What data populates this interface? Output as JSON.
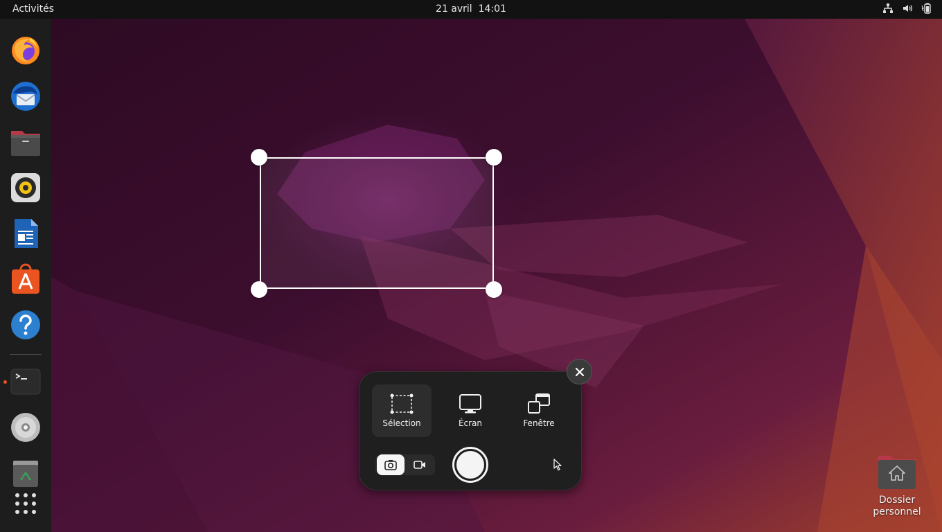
{
  "topbar": {
    "activities_label": "Activités",
    "clock": "21 avril  14:01",
    "tray_icons": [
      "network-icon",
      "volume-icon",
      "battery-icon"
    ]
  },
  "dock": {
    "apps": [
      {
        "name": "firefox",
        "icon": "firefox-icon"
      },
      {
        "name": "thunderbird",
        "icon": "thunderbird-icon"
      },
      {
        "name": "files",
        "icon": "files-icon"
      },
      {
        "name": "rhythmbox",
        "icon": "rhythmbox-icon"
      },
      {
        "name": "writer",
        "icon": "writer-icon"
      },
      {
        "name": "software",
        "icon": "software-icon"
      },
      {
        "name": "help",
        "icon": "help-icon"
      },
      {
        "name": "terminal",
        "icon": "terminal-icon",
        "running": true
      },
      {
        "name": "disc",
        "icon": "disc-icon"
      },
      {
        "name": "trash",
        "icon": "trash-icon"
      },
      {
        "name": "show-apps",
        "icon": "app-grid-icon"
      }
    ]
  },
  "screenshot_ui": {
    "modes": [
      {
        "label": "Sélection",
        "icon": "selection-icon",
        "active": true
      },
      {
        "label": "Écran",
        "icon": "monitor-icon",
        "active": false
      },
      {
        "label": "Fenêtre",
        "icon": "window-icon",
        "active": false
      }
    ],
    "capture_type": {
      "screenshot_active": true,
      "video_active": false
    },
    "show_pointer": false
  },
  "desktop": {
    "home_label_line1": "Dossier",
    "home_label_line2": "personnel"
  },
  "colors": {
    "accent": "#e95420",
    "wallpaper_dark": "#2a0a22",
    "wallpaper_mid": "#6b1e4e",
    "wallpaper_orange": "#a8402a",
    "panel_bg": "#1f1f1f"
  }
}
